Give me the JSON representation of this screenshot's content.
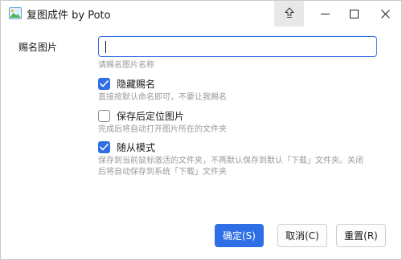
{
  "window": {
    "title": "复图成件 by Poto"
  },
  "form": {
    "name_label": "赐名图片",
    "name_input": {
      "value": "",
      "placeholder": ""
    },
    "name_hint": "请赐名图片名称",
    "options": [
      {
        "label": "隐藏赐名",
        "checked": true,
        "hint_lines": [
          "直接按默认命名即可，不要让我赐名"
        ]
      },
      {
        "label": "保存后定位图片",
        "checked": false,
        "hint_lines": [
          "完成后将自动打开图片所在的文件夹"
        ]
      },
      {
        "label": "随从模式",
        "checked": true,
        "hint_lines": [
          "保存到当前鼠标激活的文件夹，不再默认保存到默认「下载」文件夹。关闭",
          "后将自动保存到系统「下载」文件夹"
        ]
      }
    ]
  },
  "buttons": {
    "ok": "确定(S)",
    "cancel": "取消(C)",
    "reset": "重置(R)"
  },
  "colors": {
    "accent": "#2f6fe6",
    "hint_text": "#9a9a9a",
    "pin_button_bg": "#e8e8e8"
  },
  "icons": {
    "app": "image-landscape-icon",
    "pin": "pin-up-arrow-icon",
    "minimize": "minimize-icon",
    "maximize": "maximize-icon",
    "close": "close-icon",
    "checkmark": "checkmark-icon"
  }
}
